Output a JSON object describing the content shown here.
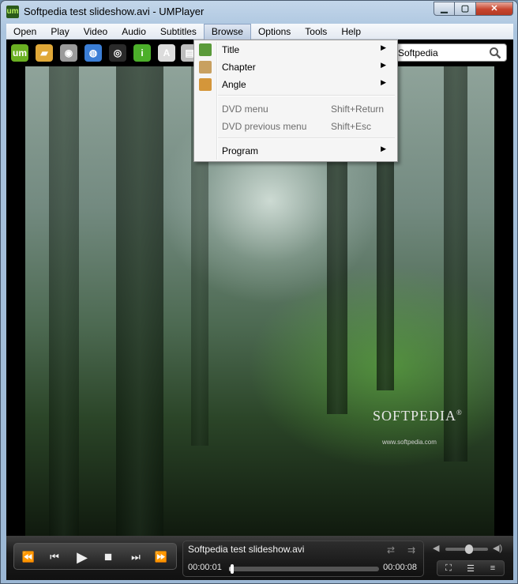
{
  "window": {
    "title": "Softpedia test slideshow.avi - UMPlayer",
    "app_icon": "um",
    "controls": {
      "minimize": "▁",
      "maximize": "▢",
      "close": "✕"
    }
  },
  "menubar": {
    "items": [
      {
        "label": "Open"
      },
      {
        "label": "Play"
      },
      {
        "label": "Video"
      },
      {
        "label": "Audio"
      },
      {
        "label": "Subtitles"
      },
      {
        "label": "Browse"
      },
      {
        "label": "Options"
      },
      {
        "label": "Tools"
      },
      {
        "label": "Help"
      }
    ],
    "active": "Browse"
  },
  "toolbar": {
    "buttons": [
      {
        "name": "um-logo-icon",
        "glyph": "um",
        "color": "#6ab022"
      },
      {
        "name": "folder-icon",
        "glyph": "▰",
        "color": "#e0a838"
      },
      {
        "name": "disc-icon",
        "glyph": "◉",
        "color": "#9a9a9a"
      },
      {
        "name": "globe-icon",
        "glyph": "◍",
        "color": "#3b7ed6"
      },
      {
        "name": "webcam-icon",
        "glyph": "◎",
        "color": "#2a2a2a"
      },
      {
        "name": "info-icon",
        "glyph": "i",
        "color": "#4caf2a"
      },
      {
        "name": "subtitle-add-icon",
        "glyph": "A",
        "color": "#dcdcdc"
      },
      {
        "name": "playlist-icon",
        "glyph": "▤",
        "color": "#bdbdbd"
      }
    ],
    "search": {
      "value": "Softpedia",
      "placeholder": ""
    }
  },
  "browse_menu": {
    "items": [
      {
        "label": "Title",
        "shortcut": "",
        "submenu": true,
        "enabled": true,
        "icon": "title-icon",
        "icon_color": "#5a9a3a"
      },
      {
        "label": "Chapter",
        "shortcut": "",
        "submenu": true,
        "enabled": true,
        "icon": "chapter-icon",
        "icon_color": "#c8a060"
      },
      {
        "label": "Angle",
        "shortcut": "",
        "submenu": true,
        "enabled": true,
        "icon": "angle-icon",
        "icon_color": "#d4963a"
      },
      {
        "label": "DVD menu",
        "shortcut": "Shift+Return",
        "submenu": false,
        "enabled": false
      },
      {
        "label": "DVD previous menu",
        "shortcut": "Shift+Esc",
        "submenu": false,
        "enabled": false
      },
      {
        "label": "Program",
        "shortcut": "",
        "submenu": true,
        "enabled": true
      }
    ],
    "arrow": "▶"
  },
  "video": {
    "watermark": "SOFTPEDIA",
    "watermark_mark": "®",
    "watermark_url": "www.softpedia.com"
  },
  "controls": {
    "transport": {
      "rewind": "⏪",
      "previous": "⏮",
      "play": "▶",
      "stop": "■",
      "next": "⏭",
      "forward": "⏩"
    },
    "now_playing": "Softpedia test slideshow.avi",
    "time_current": "00:00:01",
    "time_total": "00:00:08",
    "progress": 0.02,
    "volume": 0.55,
    "repeat": "⇄",
    "shuffle": "⇉",
    "mute": "◀",
    "volume_max": "◀)",
    "fullscreen": "⛶",
    "playlist": "☰",
    "equalizer": "≡"
  }
}
